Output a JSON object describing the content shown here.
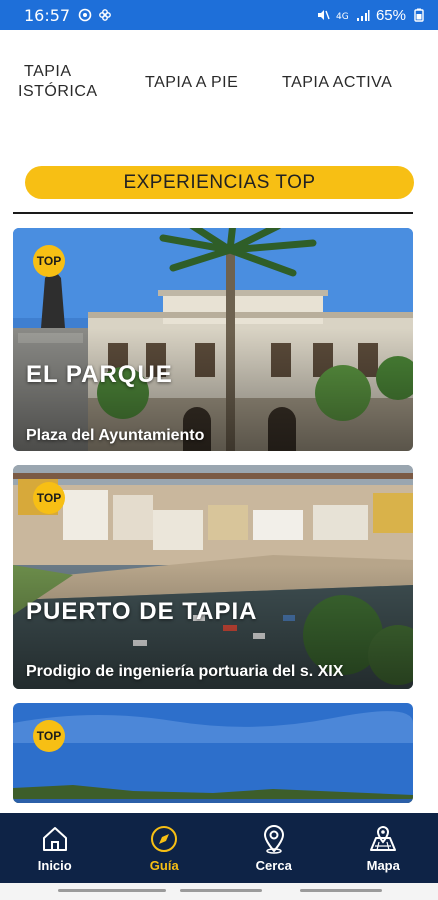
{
  "status_bar": {
    "time": "16:57",
    "battery": "65%",
    "background": "#1e6fd9"
  },
  "tabs": [
    {
      "label_line1": "TAPIA",
      "label_line2": "ISTÓRICA"
    },
    {
      "label": "TAPIA A PIE"
    },
    {
      "label": "TAPIA ACTIVA"
    }
  ],
  "section": {
    "title": "EXPERIENCIAS TOP",
    "accent": "#f7bf14"
  },
  "cards": [
    {
      "badge": "TOP",
      "title": "EL PARQUE",
      "subtitle": "Plaza del Ayuntamiento"
    },
    {
      "badge": "TOP",
      "title": "PUERTO DE TAPIA",
      "subtitle": "Prodigio de ingeniería portuaria del s. XIX"
    },
    {
      "badge": "TOP"
    }
  ],
  "bottom_nav": {
    "background": "#0e2346",
    "items": [
      {
        "label": "Inicio",
        "icon": "home-icon"
      },
      {
        "label": "Guía",
        "icon": "compass-icon",
        "active": true
      },
      {
        "label": "Cerca",
        "icon": "location-pin-icon"
      },
      {
        "label": "Mapa",
        "icon": "map-icon"
      }
    ]
  }
}
